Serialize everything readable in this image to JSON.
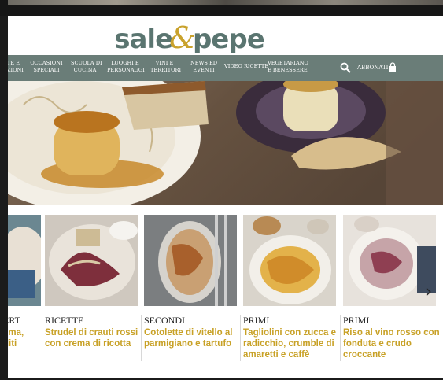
{
  "brand": {
    "logo_left": "sale",
    "logo_amp": "&",
    "logo_right": "pepe",
    "accent": "#c9a22c",
    "nav_bg": "#6a7d78",
    "title_color": "#c8a126"
  },
  "nav": {
    "items": [
      {
        "label": "TE E\nAZIONI"
      },
      {
        "label": "OCCASIONI\nSPECIALI"
      },
      {
        "label": "SCUOLA DI\nCUCINA"
      },
      {
        "label": "LUOGHI E\nPERSONAGGI"
      },
      {
        "label": "VINI E\nTERRITORI"
      },
      {
        "label": "NEWS ED\nEVENTI"
      },
      {
        "label": "VIDEO RICETTE"
      },
      {
        "label": "VEGETARIANO\nE BENESSERE"
      }
    ],
    "search_icon": "search-icon",
    "abbonati": "ABBONATI",
    "lock_icon": "lock-icon"
  },
  "cards": [
    {
      "category": "ERT",
      "title": "ema,\nditi"
    },
    {
      "category": "RICETTE",
      "title": "Strudel di crauti rossi con crema di ricotta"
    },
    {
      "category": "SECONDI",
      "title": "Cotolette di vitello al parmigiano e tartufo"
    },
    {
      "category": "PRIMI",
      "title": "Tagliolini con zucca e radicchio, crumble di amaretti e caffè"
    },
    {
      "category": "PRIMI",
      "title": "Riso al vino rosso con fonduta e crudo croccante"
    }
  ],
  "carousel": {
    "next_icon": "chevron-right-icon",
    "next_glyph": "›"
  }
}
